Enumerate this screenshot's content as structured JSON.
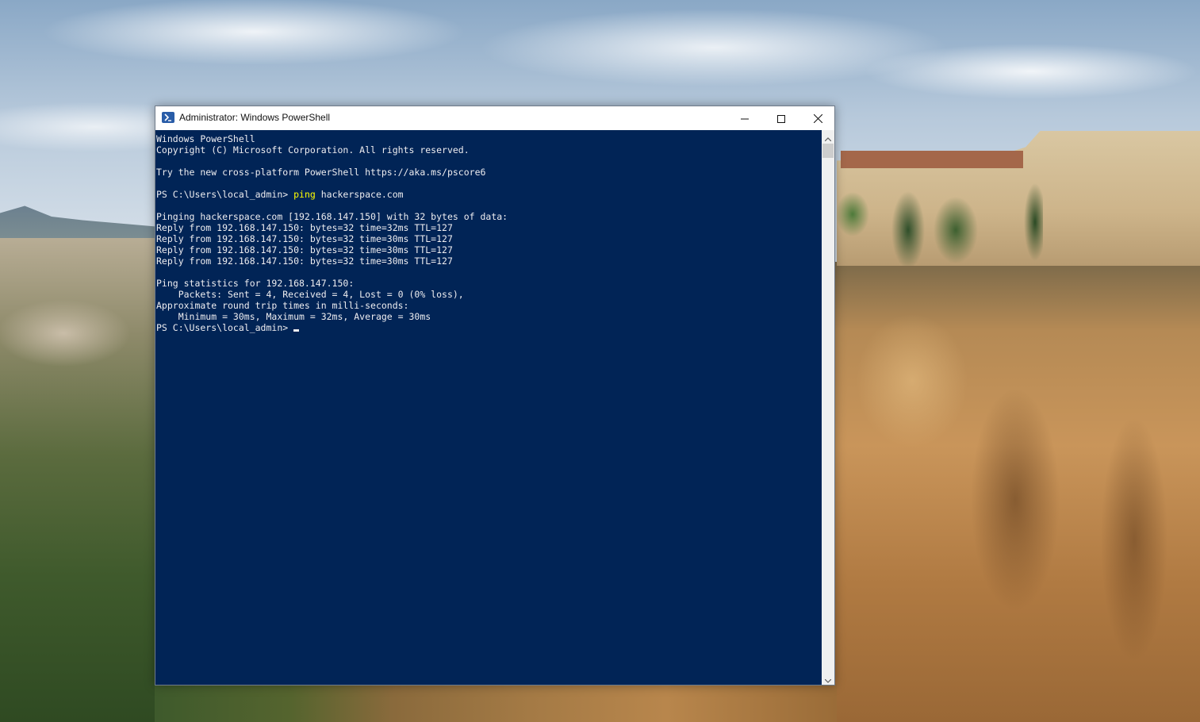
{
  "window": {
    "title": "Administrator: Windows PowerShell",
    "icon": "powershell-icon",
    "controls": {
      "minimize_icon": "minimize-icon",
      "maximize_icon": "maximize-icon",
      "close_icon": "close-icon"
    }
  },
  "console": {
    "background": "#012456",
    "foreground": "#eeedf0",
    "command_color": "#ffff00",
    "banner_lines": [
      "Windows PowerShell",
      "Copyright (C) Microsoft Corporation. All rights reserved.",
      "",
      "Try the new cross-platform PowerShell https://aka.ms/pscore6",
      ""
    ],
    "prompt": "PS C:\\Users\\local_admin> ",
    "command": "ping",
    "command_args": " hackerspace.com",
    "output_lines": [
      "",
      "Pinging hackerspace.com [192.168.147.150] with 32 bytes of data:",
      "Reply from 192.168.147.150: bytes=32 time=32ms TTL=127",
      "Reply from 192.168.147.150: bytes=32 time=30ms TTL=127",
      "Reply from 192.168.147.150: bytes=32 time=30ms TTL=127",
      "Reply from 192.168.147.150: bytes=32 time=30ms TTL=127",
      "",
      "Ping statistics for 192.168.147.150:",
      "    Packets: Sent = 4, Received = 4, Lost = 0 (0% loss),",
      "Approximate round trip times in milli-seconds:",
      "    Minimum = 30ms, Maximum = 32ms, Average = 30ms"
    ],
    "final_prompt": "PS C:\\Users\\local_admin> "
  },
  "scrollbar": {
    "up_icon": "chevron-up-icon",
    "down_icon": "chevron-down-icon"
  }
}
